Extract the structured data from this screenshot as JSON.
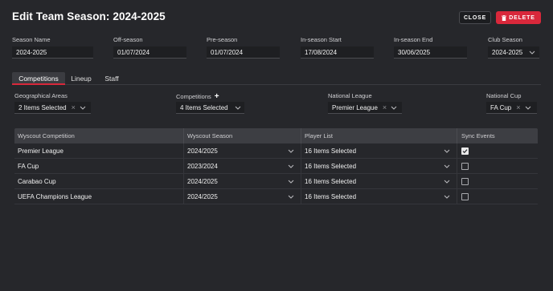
{
  "header": {
    "title": "Edit Team Season: 2024-2025",
    "close_label": "CLOSE",
    "delete_label": "DELETE"
  },
  "fields": {
    "season_name": {
      "label": "Season Name",
      "value": "2024-2025"
    },
    "off_season": {
      "label": "Off-season",
      "value": "01/07/2024"
    },
    "pre_season": {
      "label": "Pre-season",
      "value": "01/07/2024"
    },
    "in_season_start": {
      "label": "In-season Start",
      "value": "17/08/2024"
    },
    "in_season_end": {
      "label": "In-season End",
      "value": "30/06/2025"
    },
    "club_season": {
      "label": "Club Season",
      "value": "2024-2025"
    }
  },
  "tabs": [
    {
      "label": "Competitions",
      "active": true
    },
    {
      "label": "Lineup",
      "active": false
    },
    {
      "label": "Staff",
      "active": false
    }
  ],
  "filters": {
    "geographical_areas": {
      "label": "Geographical Areas",
      "value": "2 Items Selected"
    },
    "competitions": {
      "label": "Competitions",
      "value": "4 Items Selected"
    },
    "national_league": {
      "label": "National League",
      "value": "Premier League"
    },
    "national_cup": {
      "label": "National Cup",
      "value": "FA Cup"
    }
  },
  "table": {
    "headers": [
      "Wyscout Competition",
      "Wyscout Season",
      "Player List",
      "Sync Events"
    ],
    "rows": [
      {
        "competition": "Premier League",
        "season": "2024/2025",
        "player_list": "16 Items Selected",
        "sync": true
      },
      {
        "competition": "FA Cup",
        "season": "2023/2024",
        "player_list": "16 Items Selected",
        "sync": false
      },
      {
        "competition": "Carabao Cup",
        "season": "2024/2025",
        "player_list": "16 Items Selected",
        "sync": false
      },
      {
        "competition": "UEFA Champions League",
        "season": "2024/2025",
        "player_list": "16 Items Selected",
        "sync": false
      }
    ]
  },
  "colors": {
    "accent": "#d9283b",
    "background": "#26272b"
  }
}
